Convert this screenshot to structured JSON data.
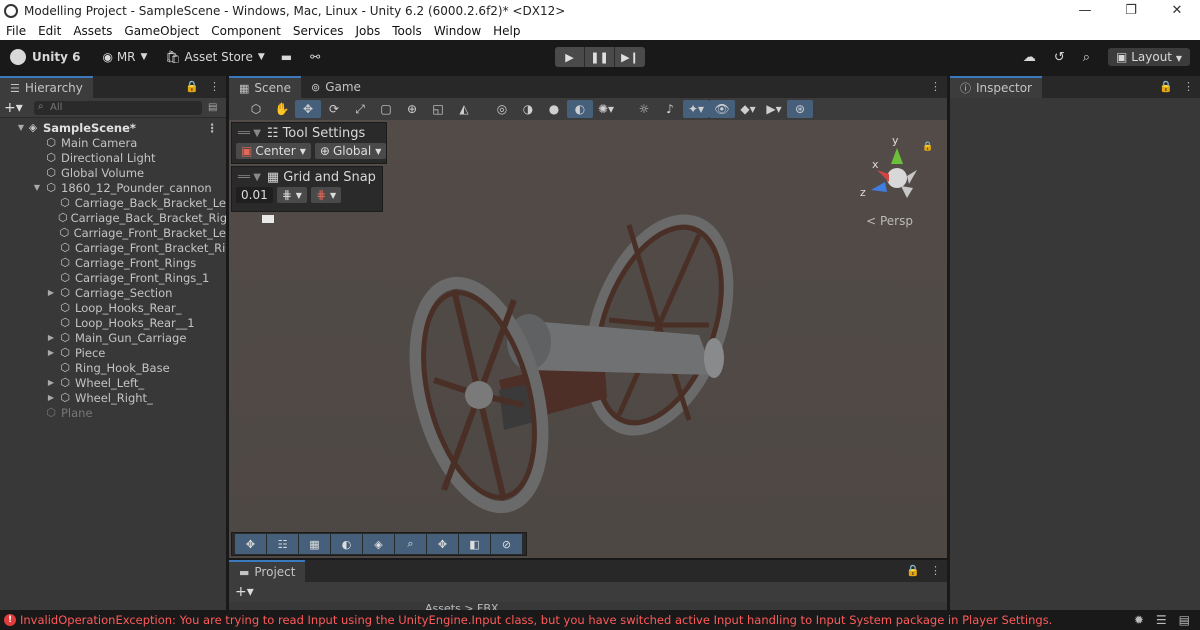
{
  "window": {
    "title": "Modelling Project - SampleScene - Windows, Mac, Linux - Unity 6.2 (6000.2.6f2)* <DX12>",
    "minimize": "—",
    "maximize": "❐",
    "close": "✕"
  },
  "menu": [
    "File",
    "Edit",
    "Assets",
    "GameObject",
    "Component",
    "Services",
    "Jobs",
    "Tools",
    "Window",
    "Help"
  ],
  "toolbar": {
    "brand": "Unity 6",
    "account": "MR",
    "asset_store": "Asset Store",
    "layout": "Layout"
  },
  "hierarchy": {
    "tab": "Hierarchy",
    "search_placeholder": "All",
    "scene": "SampleScene*",
    "items": [
      "Main Camera",
      "Directional Light",
      "Global Volume",
      "1860_12_Pounder_cannon",
      "Carriage_Back_Bracket_Le",
      "Carriage_Back_Bracket_Rig",
      "Carriage_Front_Bracket_Le",
      "Carriage_Front_Bracket_Ri",
      "Carriage_Front_Rings",
      "Carriage_Front_Rings_1",
      "Carriage_Section",
      "Loop_Hooks_Rear_",
      "Loop_Hooks_Rear__1",
      "Main_Gun_Carriage",
      "Piece",
      "Ring_Hook_Base",
      "Wheel_Left_",
      "Wheel_Right_",
      "Plane"
    ]
  },
  "scene": {
    "tab_scene": "Scene",
    "tab_game": "Game",
    "tool_settings": "Tool Settings",
    "pivot": "Center",
    "space": "Global",
    "grid_snap": "Grid and Snap",
    "snap_value": "0.01",
    "persp": "< Persp",
    "axis_x": "x",
    "axis_y": "y",
    "axis_z": "z"
  },
  "inspector": {
    "tab": "Inspector"
  },
  "project": {
    "tab": "Project",
    "breadcrumb": "Assets > FBX"
  },
  "status": {
    "error": "InvalidOperationException: You are trying to read Input using the UnityEngine.Input class, but you have switched active Input handling to Input System package in Player Settings."
  },
  "colors": {
    "accent": "#3a79bb",
    "error": "#ff5a5a",
    "panel": "#383838",
    "toolbar": "#191919"
  }
}
